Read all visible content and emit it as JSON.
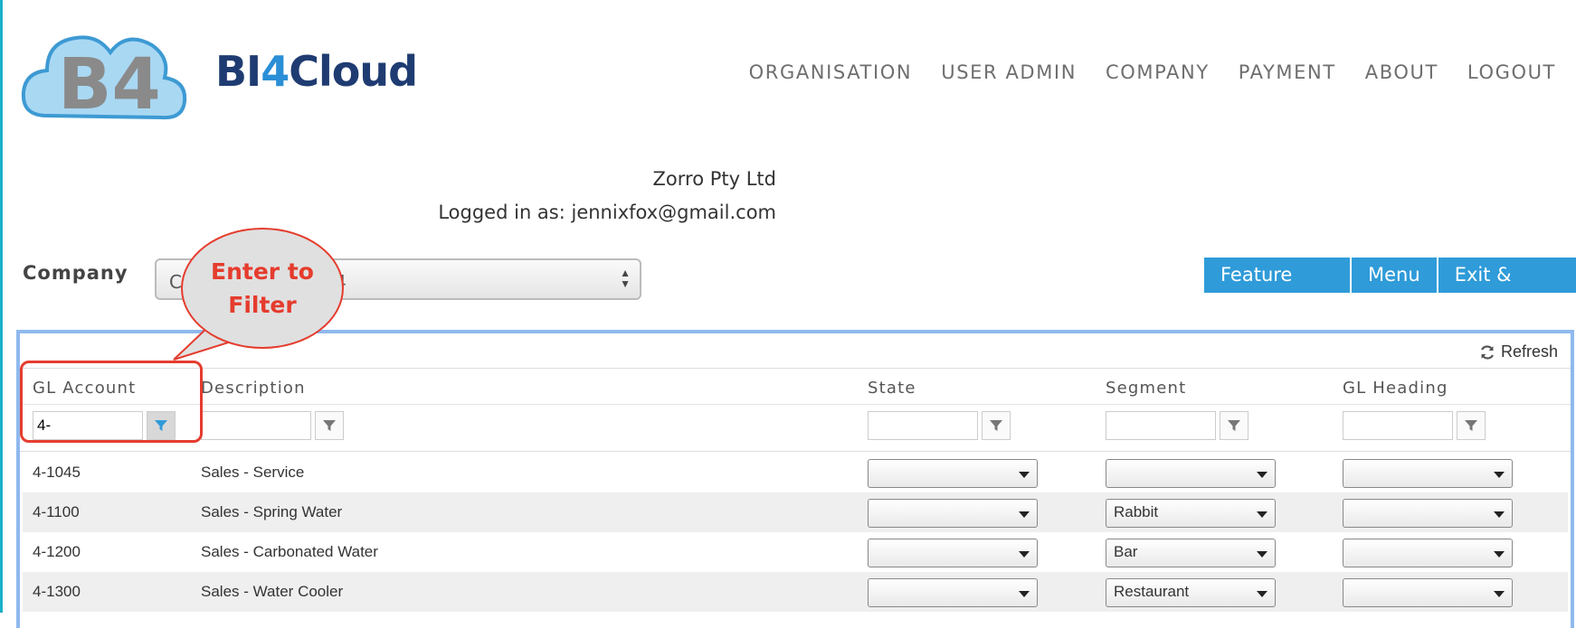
{
  "brand": {
    "prefix": "BI",
    "four": "4",
    "suffix": "Cloud",
    "logo_text": "B4"
  },
  "nav": [
    "ORGANISATION",
    "USER ADMIN",
    "COMPANY",
    "PAYMENT",
    "ABOUT",
    "LOGOUT"
  ],
  "info": {
    "company": "Zorro Pty Ltd",
    "logged_in": "Logged in as: jennixfox@gmail.com"
  },
  "company": {
    "label": "Company",
    "selected": "Cl",
    "selected_tail": "l4"
  },
  "buttons": {
    "feature_tour": "Feature Tour",
    "menu": "Menu",
    "exit_save": "Exit & Save"
  },
  "callout": {
    "line1": "Enter to",
    "line2": "Filter"
  },
  "grid": {
    "refresh": "Refresh",
    "columns": [
      "GL Account",
      "Description",
      "State",
      "Segment",
      "GL Heading"
    ],
    "filter_gl_account": "4-",
    "rows": [
      {
        "account": "4-1045",
        "description": "Sales - Service",
        "state": "",
        "segment": "",
        "heading": ""
      },
      {
        "account": "4-1100",
        "description": "Sales - Spring Water",
        "state": "",
        "segment": "Rabbit",
        "heading": ""
      },
      {
        "account": "4-1200",
        "description": "Sales - Carbonated Water",
        "state": "",
        "segment": "Bar",
        "heading": ""
      },
      {
        "account": "4-1300",
        "description": "Sales - Water Cooler",
        "state": "",
        "segment": "Restaurant",
        "heading": ""
      }
    ]
  },
  "colors": {
    "accent": "#2f9bd9",
    "callout": "#e53c2e",
    "grid_border": "#8fb9ee",
    "brand": "#1f3c72"
  }
}
